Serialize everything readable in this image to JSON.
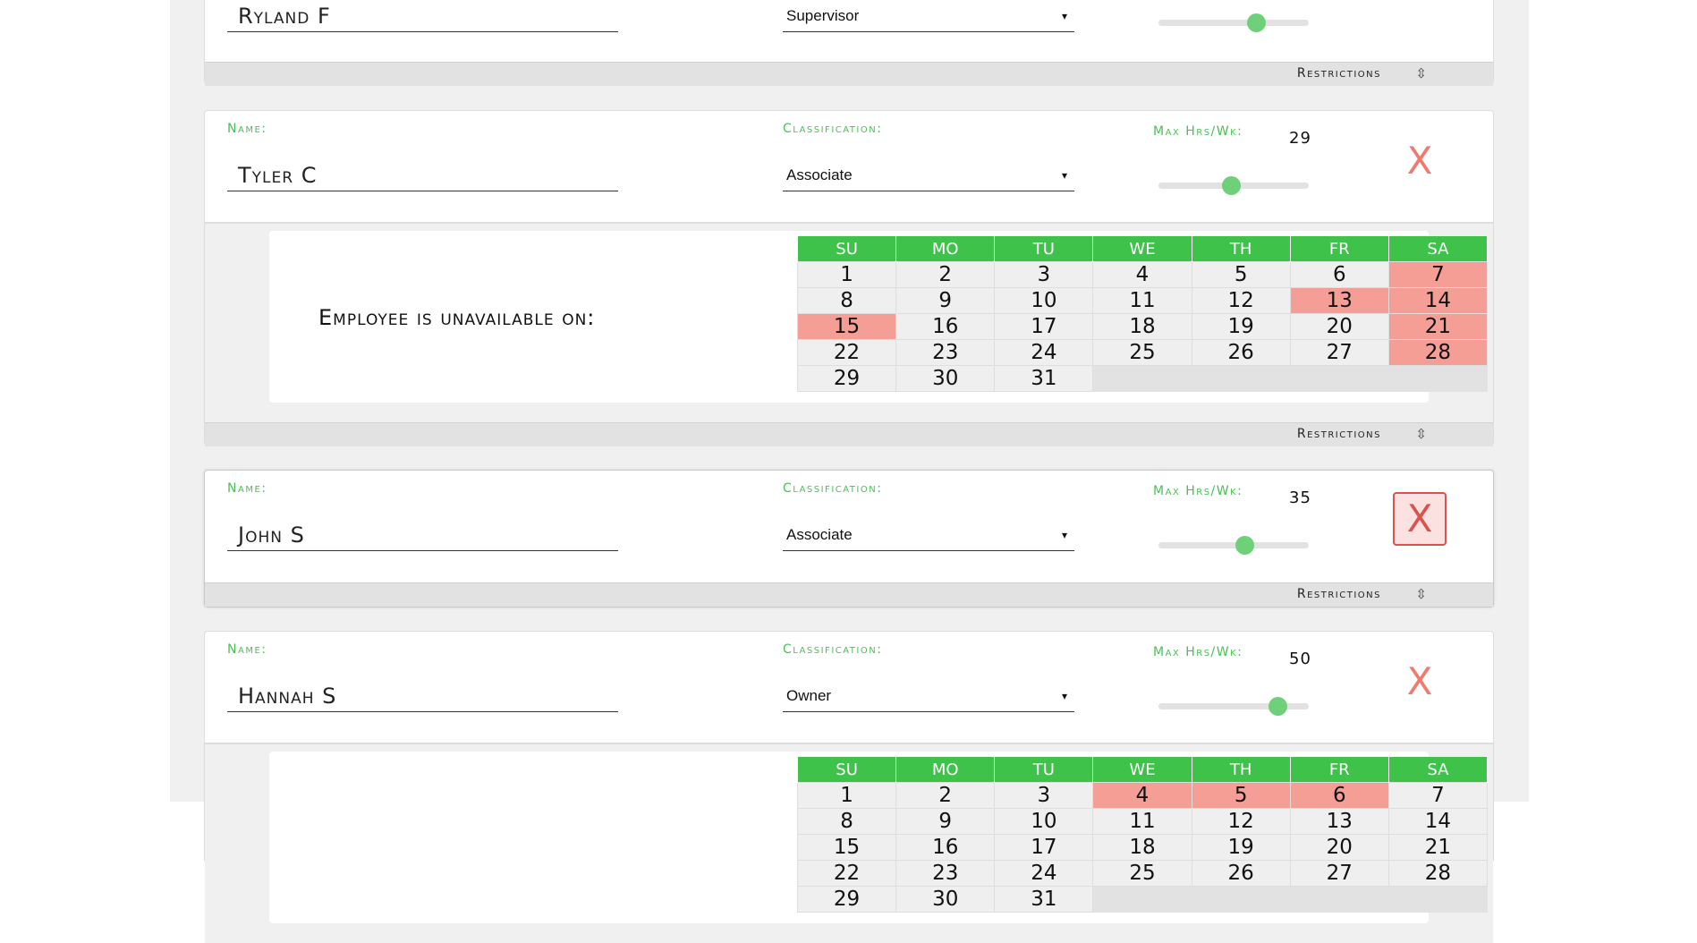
{
  "labels": {
    "name": "Name:",
    "classification": "Classification:",
    "max_hrs": "Max Hrs/Wk:",
    "restrictions": "Restrictions",
    "unavailable": "Employee is unavailable on:",
    "delete": "X",
    "caret": "▾",
    "expand": "⇳"
  },
  "calendar_headers": [
    "SU",
    "MO",
    "TU",
    "WE",
    "TH",
    "FR",
    "SA"
  ],
  "employees": [
    {
      "name": "Ryland F",
      "classification": "Supervisor",
      "max_hrs": 40,
      "unavailable_days": []
    },
    {
      "name": "Tyler C",
      "classification": "Associate",
      "max_hrs": 29,
      "max_hrs_text": "29",
      "unavailable_days": [
        7,
        13,
        14,
        15,
        21,
        28
      ]
    },
    {
      "name": "John S",
      "classification": "Associate",
      "max_hrs": 35,
      "max_hrs_text": "35",
      "unavailable_days": []
    },
    {
      "name": "Hannah S",
      "classification": "Owner",
      "max_hrs": 50,
      "max_hrs_text": "50",
      "unavailable_days": [
        4,
        5,
        6
      ]
    }
  ],
  "colors": {
    "accent_green": "#3ec24a",
    "label_green": "#4cbf57",
    "unavailable_red": "#f59e96",
    "delete_red": "#ef7b70"
  }
}
